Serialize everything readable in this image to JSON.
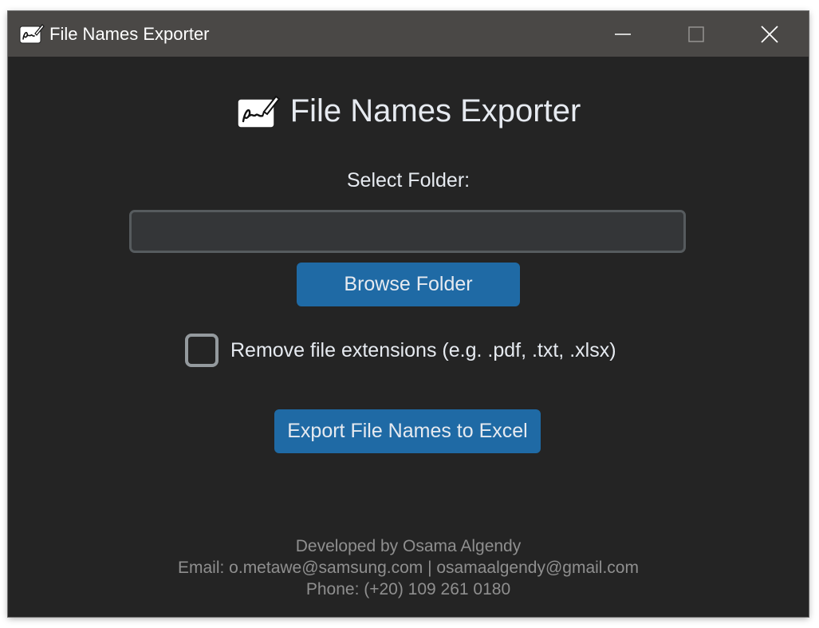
{
  "window": {
    "title": "File Names Exporter",
    "app_icon": "signature-icon",
    "controls": {
      "minimize": "minimize-icon",
      "maximize": "maximize-icon",
      "close": "close-icon"
    }
  },
  "main": {
    "heading": "File Names Exporter",
    "heading_icon": "signature-icon",
    "select_folder_label": "Select Folder:",
    "folder_input": {
      "value": "",
      "placeholder": ""
    },
    "browse_button_label": "Browse Folder",
    "remove_extensions": {
      "label": "Remove file extensions (e.g. .pdf, .txt, .xlsx)",
      "checked": false
    },
    "export_button_label": "Export File Names to Excel"
  },
  "footer": {
    "developer": "Developed by Osama Algendy",
    "email": "Email: o.metawe@samsung.com | osamaalgendy@gmail.com",
    "phone": "Phone: (+20) 109 261 0180"
  },
  "colors": {
    "background": "#242424",
    "titlebar": "#4a4846",
    "accent": "#1f6aa5",
    "input_bg": "#343638",
    "input_border": "#565b5e",
    "text": "#e6eaf0",
    "footer_text": "#8f8f8f"
  }
}
